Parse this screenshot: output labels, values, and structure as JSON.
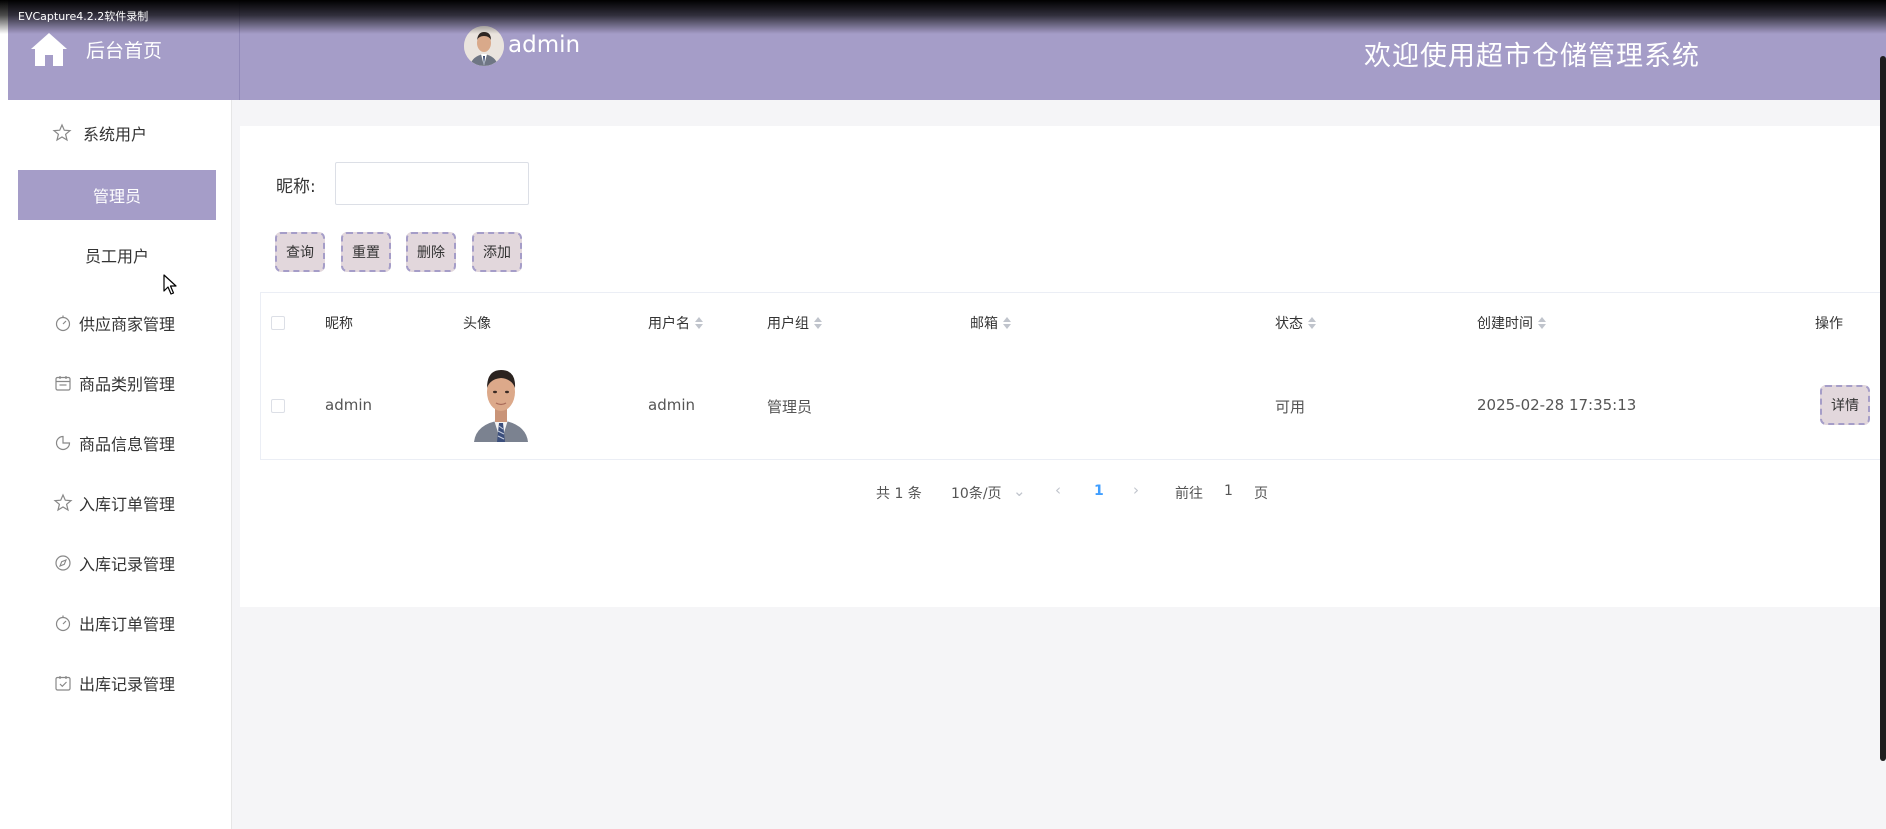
{
  "recorder_label": "EVCapture4.2.2软件录制",
  "header": {
    "home_label": "后台首页",
    "admin_name": "admin",
    "welcome": "欢迎使用超市仓储管理系统"
  },
  "colors": {
    "accent": "#a59dc8",
    "button_bg": "#e2d7dc",
    "page_bg": "#f5f5f7"
  },
  "sidebar": {
    "group_label": "系统用户",
    "sub_items": [
      "管理员",
      "员工用户"
    ],
    "active_sub": "管理员",
    "items": [
      {
        "label": "供应商家管理",
        "icon": "timer-icon"
      },
      {
        "label": "商品类别管理",
        "icon": "calendar-icon"
      },
      {
        "label": "商品信息管理",
        "icon": "pie-icon"
      },
      {
        "label": "入库订单管理",
        "icon": "star-icon"
      },
      {
        "label": "入库记录管理",
        "icon": "compass-icon"
      },
      {
        "label": "出库订单管理",
        "icon": "timer-icon"
      },
      {
        "label": "出库记录管理",
        "icon": "check-calendar-icon"
      }
    ]
  },
  "search": {
    "label": "昵称:",
    "value": ""
  },
  "buttons": {
    "query": "查询",
    "reset": "重置",
    "delete": "删除",
    "add": "添加"
  },
  "table": {
    "headers": {
      "nickname": "昵称",
      "avatar": "头像",
      "username": "用户名",
      "group": "用户组",
      "email": "邮箱",
      "status": "状态",
      "created": "创建时间",
      "action": "操作"
    },
    "rows": [
      {
        "nickname": "admin",
        "username": "admin",
        "group": "管理员",
        "email": "",
        "status": "可用",
        "created": "2025-02-28 17:35:13",
        "action": "详情"
      }
    ]
  },
  "pagination": {
    "total": "共 1 条",
    "page_size": "10条/页",
    "current_page": "1",
    "goto_label": "前往",
    "goto_value": "1",
    "page_suffix": "页"
  }
}
